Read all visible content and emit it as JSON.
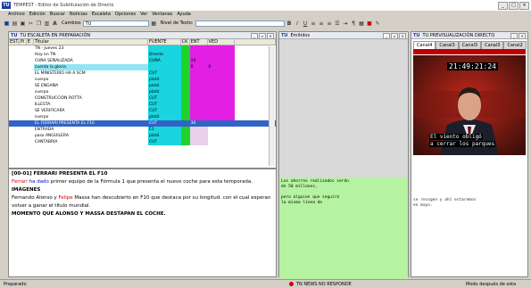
{
  "window": {
    "title": "TEMPEST - Editor de Subtitulación de Directo",
    "logo": "TU"
  },
  "menu": [
    "Archivo",
    "Edición",
    "Buscar",
    "Noticias",
    "Escaleta",
    "Opciones",
    "Ver",
    "Ventanas",
    "Ayuda"
  ],
  "toolbar": {
    "cambios_label": "Cambios",
    "cambios_value": "TU",
    "nivel_label": "Nivel de Texto:",
    "nivel_value": ""
  },
  "escaleta": {
    "title": "TU ESCALETA EN PREPARACIÓN",
    "columns": [
      "EST.",
      "Pi",
      "E",
      "Titular",
      "FUENTE",
      "CK",
      "ENT",
      "VED",
      ""
    ],
    "rows": [
      {
        "titular": "TN - Jueves 23",
        "fuente": "",
        "ck": "",
        "ent": "",
        "ved": ""
      },
      {
        "titular": "Hoy en TN",
        "fuente": "Directo",
        "ck": "",
        "ent": "",
        "ved": ""
      },
      {
        "titular": "CUÑA SEÑALIZADA",
        "fuente": "CUÑA",
        "ck": "",
        "ent": "10",
        "ved": ""
      },
      {
        "titular": "cuenta la gloria",
        "fuente": "",
        "ck": "",
        "ent": "0",
        "ved": "0"
      },
      {
        "titular": "EL MINISTERIO HA A SCM",
        "fuente": "CUT",
        "ck": "",
        "ent": "",
        "ved": ""
      },
      {
        "titular": "cuerpo",
        "fuente": "plató",
        "ck": "",
        "ent": "",
        "ved": ""
      },
      {
        "titular": "SE ENGAÑA",
        "fuente": "plató",
        "ck": "",
        "ent": "",
        "ved": ""
      },
      {
        "titular": "cuerpo",
        "fuente": "plató",
        "ck": "",
        "ent": "",
        "ved": ""
      },
      {
        "titular": "CONSTRUCCIÓN ROTTA",
        "fuente": "CUT",
        "ck": "",
        "ent": "",
        "ved": ""
      },
      {
        "titular": "ILLESTA",
        "fuente": "CUT",
        "ck": "",
        "ent": "",
        "ved": ""
      },
      {
        "titular": "SE VERIFICARÁ",
        "fuente": "CUT",
        "ck": "",
        "ent": "",
        "ved": ""
      },
      {
        "titular": "cuerpo",
        "fuente": "plató",
        "ck": "",
        "ent": "",
        "ved": ""
      },
      {
        "titular": "EL FERRARI PRESENTA EL F10",
        "fuente": "CUT",
        "ck": "",
        "ent": "30",
        "ved": "",
        "selected": true
      },
      {
        "titular": "ENTRADA",
        "fuente": "E1",
        "ck": "",
        "ent": "",
        "ved": ""
      },
      {
        "titular": "paso ANGUILERA",
        "fuente": "plató",
        "ck": "",
        "ent": "",
        "ved": ""
      },
      {
        "titular": "CANTABRIA",
        "fuente": "CUT",
        "ck": "",
        "ent": "",
        "ved": ""
      }
    ]
  },
  "editor": {
    "heading": "[00-01] FERRARI PRESENTA EL F10",
    "line1_red": "Ferrari",
    "line1_blue": "ha dado",
    "line1_rest": " primer equipo de la Fórmula 1 que presenta el nuevo coche para esta temporada.",
    "imagenes": "IMÁGENES",
    "line2_a": "Fernando Alonso y ",
    "line2_red": "Felipe",
    "line2_b": " Massa han descubierto en F10 que destaca por su longitud.  con el cual esperan volver a ganar el título mundial.",
    "closing": "MOMENTO QUE ALONSO Y MASSA DESTAPAN EL COCHE."
  },
  "emision": {
    "title": "Emitidos",
    "lines": [
      "Los ahorros realizados serán",
      "de 50 millones,",
      "",
      "pero alguien que seguirá",
      "la misma línea de"
    ]
  },
  "tv": {
    "title": "TU PREVISUALIZACIÓN DIRECTO",
    "channels": [
      "Canal4",
      "Canal3",
      "Canal3",
      "Canal3",
      "Canal2"
    ],
    "timecode": "21:49:21:24",
    "subtitle1": "El viento obligó",
    "subtitle2": "a cerrar los parques",
    "notes": [
      "se recogen y ahí estaremos",
      "en mayo."
    ]
  },
  "status": {
    "left": "Preparado",
    "center": "TN NEWS NO RESPONDE",
    "right": "Modo después de esta"
  },
  "colors": {
    "cyan": "#19d5e0",
    "green": "#1cd42c",
    "magenta": "#e31fe3",
    "select": "#3164c6",
    "light_green": "#b5f2a2"
  }
}
